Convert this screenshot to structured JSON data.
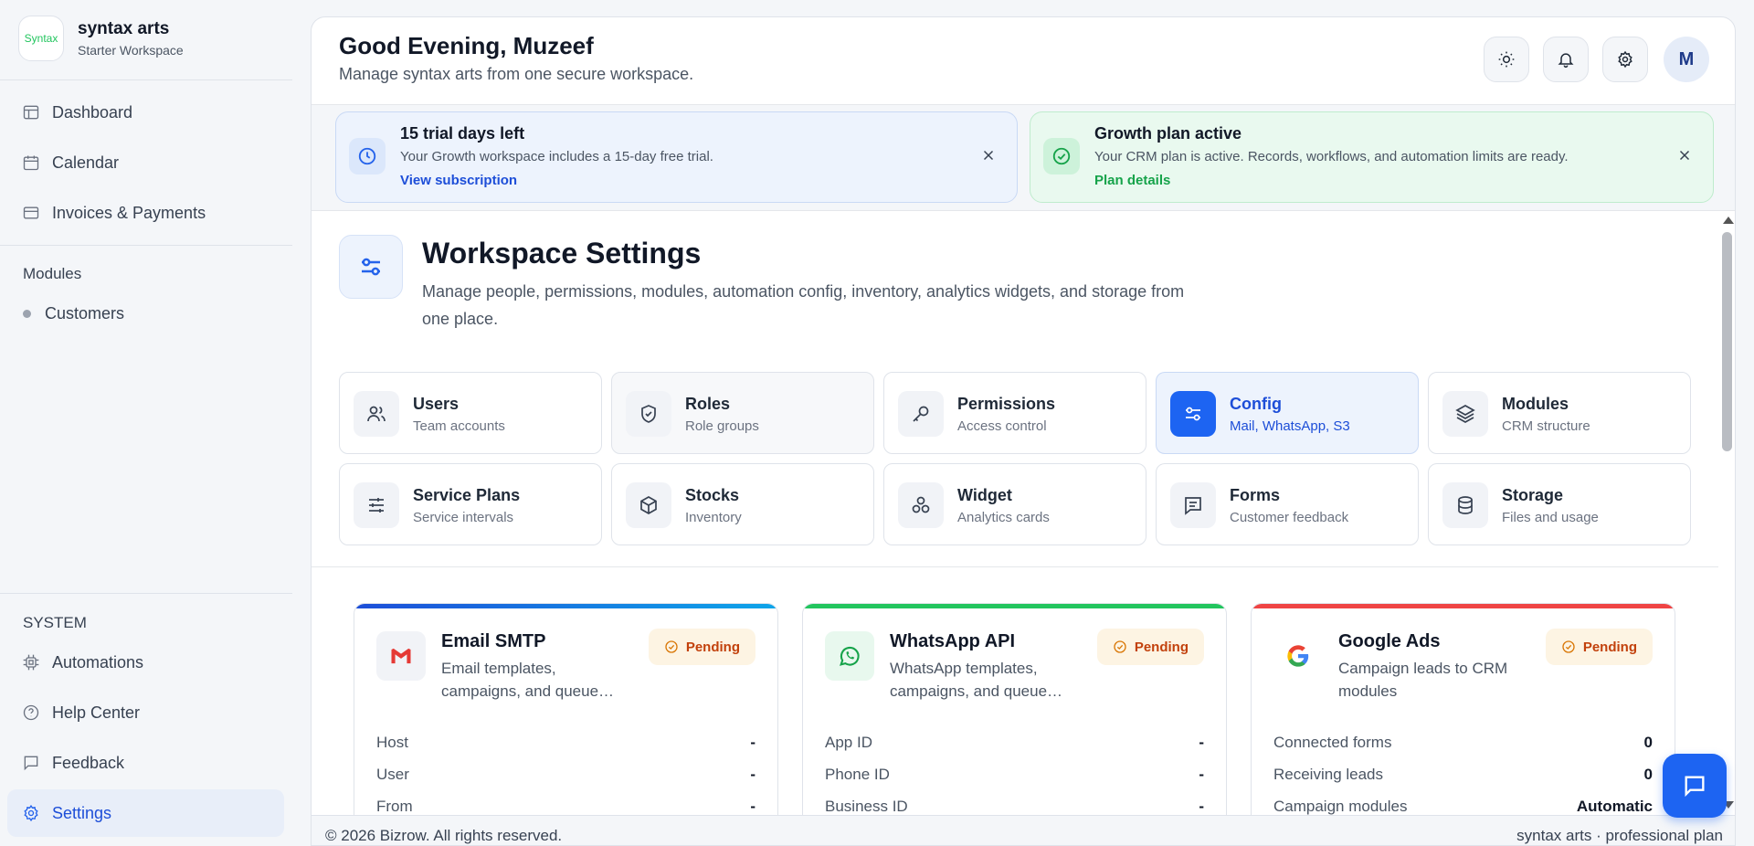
{
  "brand": {
    "logo_text": "Syntax",
    "name": "syntax arts",
    "subtitle": "Starter Workspace"
  },
  "sidebar": {
    "nav": [
      {
        "label": "Dashboard",
        "icon": "dashboard-icon"
      },
      {
        "label": "Calendar",
        "icon": "calendar-icon"
      },
      {
        "label": "Invoices & Payments",
        "icon": "card-icon"
      }
    ],
    "modules_label": "Modules",
    "modules": [
      {
        "label": "Customers"
      }
    ],
    "system_label": "SYSTEM",
    "system": [
      {
        "label": "Automations",
        "icon": "cpu-icon"
      },
      {
        "label": "Help Center",
        "icon": "help-icon"
      },
      {
        "label": "Feedback",
        "icon": "message-icon"
      },
      {
        "label": "Settings",
        "icon": "gear-icon",
        "active": true
      }
    ]
  },
  "header": {
    "greeting": "Good Evening, Muzeef",
    "subtitle": "Manage syntax arts from one secure workspace.",
    "avatar_initial": "M"
  },
  "banners": {
    "trial": {
      "title": "15 trial days left",
      "desc": "Your Growth workspace includes a 15-day free trial.",
      "link": "View subscription"
    },
    "plan": {
      "title": "Growth plan active",
      "desc": "Your CRM plan is active. Records, workflows, and automation limits are ready.",
      "link": "Plan details"
    }
  },
  "workspace": {
    "title": "Workspace Settings",
    "desc": "Manage people, permissions, modules, automation config, inventory, analytics widgets, and storage from one place."
  },
  "tiles": [
    {
      "title": "Users",
      "sub": "Team accounts",
      "icon": "users-icon"
    },
    {
      "title": "Roles",
      "sub": "Role groups",
      "icon": "shield-icon"
    },
    {
      "title": "Permissions",
      "sub": "Access control",
      "icon": "key-icon"
    },
    {
      "title": "Config",
      "sub": "Mail, WhatsApp, S3",
      "icon": "sliders-icon",
      "selected": true
    },
    {
      "title": "Modules",
      "sub": "CRM structure",
      "icon": "layers-icon"
    },
    {
      "title": "Service Plans",
      "sub": "Service intervals",
      "icon": "tune-icon"
    },
    {
      "title": "Stocks",
      "sub": "Inventory",
      "icon": "box-icon"
    },
    {
      "title": "Widget",
      "sub": "Analytics cards",
      "icon": "widget-icon"
    },
    {
      "title": "Forms",
      "sub": "Customer feedback",
      "icon": "form-icon"
    },
    {
      "title": "Storage",
      "sub": "Files and usage",
      "icon": "database-icon"
    }
  ],
  "cards": [
    {
      "title": "Email SMTP",
      "desc": "Email templates, campaigns, and queue…",
      "status": "Pending",
      "icon": "gmail-icon",
      "bar_color": "#1d64f2",
      "rows": [
        {
          "k": "Host",
          "v": "-"
        },
        {
          "k": "User",
          "v": "-"
        },
        {
          "k": "From",
          "v": "-"
        }
      ]
    },
    {
      "title": "WhatsApp API",
      "desc": "WhatsApp templates, campaigns, and queue…",
      "status": "Pending",
      "icon": "whatsapp-icon",
      "bar_color": "#22c55e",
      "rows": [
        {
          "k": "App ID",
          "v": "-"
        },
        {
          "k": "Phone ID",
          "v": "-"
        },
        {
          "k": "Business ID",
          "v": "-"
        }
      ]
    },
    {
      "title": "Google Ads",
      "desc": "Campaign leads to CRM modules",
      "status": "Pending",
      "icon": "google-icon",
      "bar_color": "#ef4444",
      "rows": [
        {
          "k": "Connected forms",
          "v": "0"
        },
        {
          "k": "Receiving leads",
          "v": "0"
        },
        {
          "k": "Campaign modules",
          "v": "Automatic"
        }
      ]
    }
  ],
  "footer": {
    "left": "© 2026 Bizrow. All rights reserved.",
    "right": "syntax arts · professional plan"
  }
}
